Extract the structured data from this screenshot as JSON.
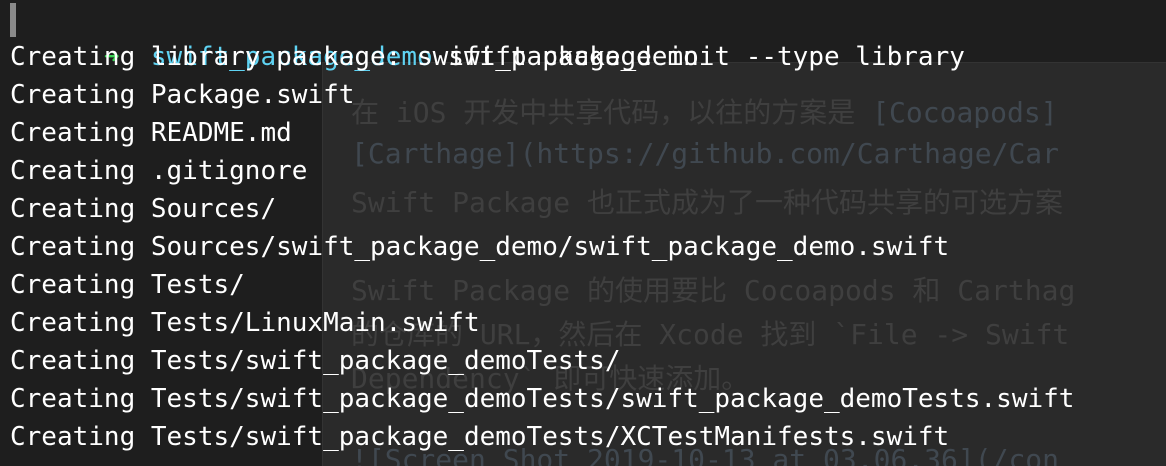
{
  "prompt": {
    "arrow": "➜",
    "directory": "swift_package_demo",
    "command": " swift package init --type library"
  },
  "output": [
    "Creating library package: swift_package_demo",
    "Creating Package.swift",
    "Creating README.md",
    "Creating .gitignore",
    "Creating Sources/",
    "Creating Sources/swift_package_demo/swift_package_demo.swift",
    "Creating Tests/",
    "Creating Tests/LinuxMain.swift",
    "Creating Tests/swift_package_demoTests/",
    "Creating Tests/swift_package_demoTests/swift_package_demoTests.swift",
    "Creating Tests/swift_package_demoTests/XCTestManifests.swift"
  ],
  "colors": {
    "background": "#1e1e1e",
    "prompt_arrow": "#39d353",
    "prompt_directory": "#5fd3f3",
    "text": "#ffffff"
  }
}
